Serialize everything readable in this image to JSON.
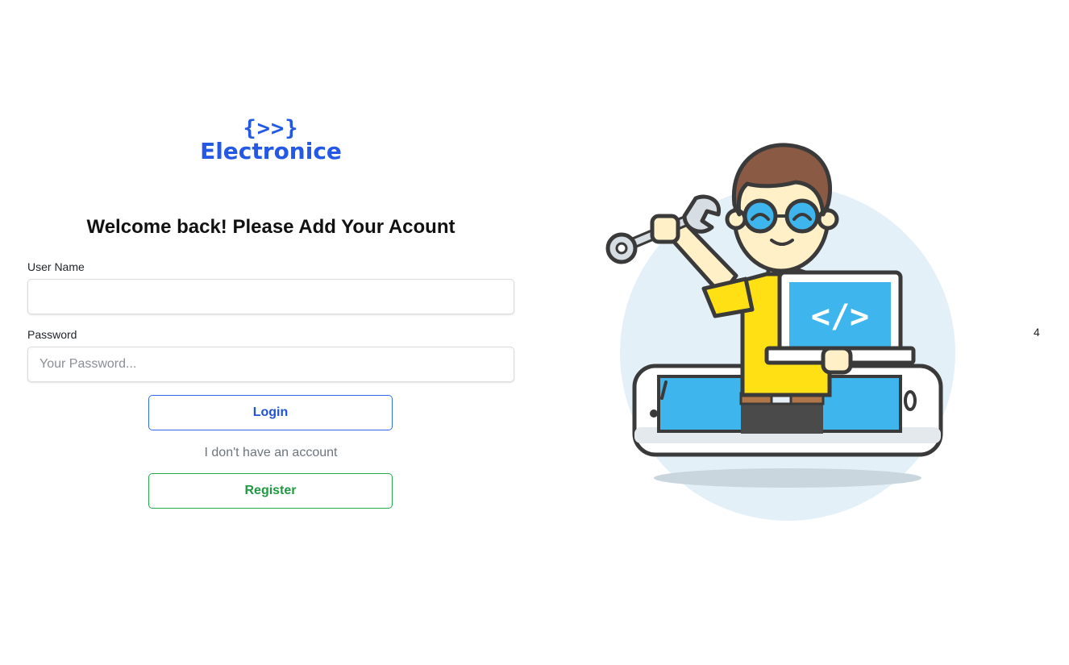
{
  "brand": {
    "code": "{>>}",
    "name": "Electronice"
  },
  "login_form": {
    "heading": "Welcome back! Please Add Your Acount",
    "username_label": "User Name",
    "username_value": "",
    "username_placeholder": "",
    "password_label": "Password",
    "password_value": "",
    "password_placeholder": "Your Password...",
    "login_label": "Login",
    "no_account_text": "I don't have an account",
    "register_label": "Register"
  },
  "illustration": {
    "icon": "developer-with-wrench-and-laptop-icon",
    "code_symbol": "</>"
  },
  "side_number": "4",
  "colors": {
    "brand": "#2459e6",
    "login_accent": "#2f6bf0",
    "register_accent": "#27a84a"
  }
}
